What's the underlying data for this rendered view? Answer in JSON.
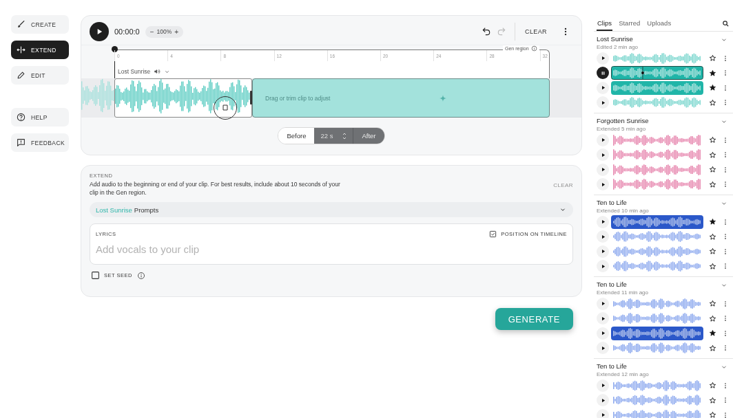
{
  "nav": {
    "primary": [
      {
        "kind": "create",
        "label": "CREATE",
        "selected": false
      },
      {
        "kind": "extend",
        "label": "EXTEND",
        "selected": true
      },
      {
        "kind": "edit",
        "label": "EDIT",
        "selected": false
      }
    ],
    "secondary": [
      {
        "kind": "help",
        "label": "HELP",
        "selected": false
      },
      {
        "kind": "feedback",
        "label": "FEEDBACK",
        "selected": false
      }
    ]
  },
  "player": {
    "time": "00:00:0",
    "zoom": {
      "minus": "−",
      "value": "100%",
      "plus": "+"
    },
    "clear": "CLEAR",
    "redo_disabled": true
  },
  "timeline": {
    "ticks": [
      "0",
      "4",
      "8",
      "12",
      "16",
      "20",
      "24",
      "28",
      "32"
    ],
    "gen_region": "Gen region",
    "clip_name": "Lost Sunrise",
    "hint": "Drag or trim clip to adjust",
    "modes": [
      {
        "label": "Before",
        "selected": false
      },
      {
        "label": "After",
        "selected": true
      }
    ],
    "duration": "22 s"
  },
  "extend": {
    "heading": "EXTEND",
    "description": "Add audio to the beginning or end of your clip. For best results, include about 10 seconds of your clip in the Gen region.",
    "clear": "CLEAR",
    "clear_disabled": true,
    "prompts": {
      "clip_name": "Lost Sunrise",
      "label": "Prompts"
    },
    "lyrics": {
      "label": "LYRICS",
      "placeholder": "Add vocals to your clip",
      "position_label": "POSITION ON TIMELINE",
      "position_checked": true
    },
    "seed": {
      "label": "SET SEED",
      "checked": false
    },
    "generate": "GENERATE"
  },
  "library": {
    "tabs": [
      {
        "label": "Clips",
        "selected": true
      },
      {
        "label": "Starred",
        "selected": false
      },
      {
        "label": "Uploads",
        "selected": false
      }
    ],
    "groups": [
      {
        "title": "Lost Sunrise",
        "subtitle": "Edited 2 min ago",
        "color": "#7fd8d0",
        "clips": [
          {
            "playing": false,
            "selected": false,
            "starred": false
          },
          {
            "playing": true,
            "selected": true,
            "starred": true
          },
          {
            "playing": false,
            "selected": true,
            "starred": true
          },
          {
            "playing": false,
            "selected": false,
            "starred": false
          }
        ]
      },
      {
        "title": "Forgotten Sunrise",
        "subtitle": "Extended 5 min ago",
        "color": "#e88cb2",
        "clips": [
          {
            "playing": false,
            "selected": false,
            "starred": false
          },
          {
            "playing": false,
            "selected": false,
            "starred": false
          },
          {
            "playing": false,
            "selected": false,
            "starred": false
          },
          {
            "playing": false,
            "selected": false,
            "starred": false
          }
        ]
      },
      {
        "title": "Ten to Life",
        "subtitle": "Extended 10 min ago",
        "color": "#91acef",
        "clips": [
          {
            "playing": false,
            "selected": true,
            "starred": true
          },
          {
            "playing": false,
            "selected": false,
            "starred": false
          },
          {
            "playing": false,
            "selected": false,
            "starred": false
          },
          {
            "playing": false,
            "selected": false,
            "starred": false
          }
        ]
      },
      {
        "title": "Ten to Life",
        "subtitle": "Extended 11 min ago",
        "color": "#91acef",
        "clips": [
          {
            "playing": false,
            "selected": false,
            "starred": false
          },
          {
            "playing": false,
            "selected": false,
            "starred": false
          },
          {
            "playing": false,
            "selected": true,
            "starred": true
          },
          {
            "playing": false,
            "selected": false,
            "starred": false
          }
        ]
      },
      {
        "title": "Ten to Life",
        "subtitle": "Extended 12 min ago",
        "color": "#91acef",
        "clips": [
          {
            "playing": false,
            "selected": false,
            "starred": false
          },
          {
            "playing": false,
            "selected": false,
            "starred": false
          },
          {
            "playing": false,
            "selected": false,
            "starred": false
          }
        ]
      }
    ]
  }
}
